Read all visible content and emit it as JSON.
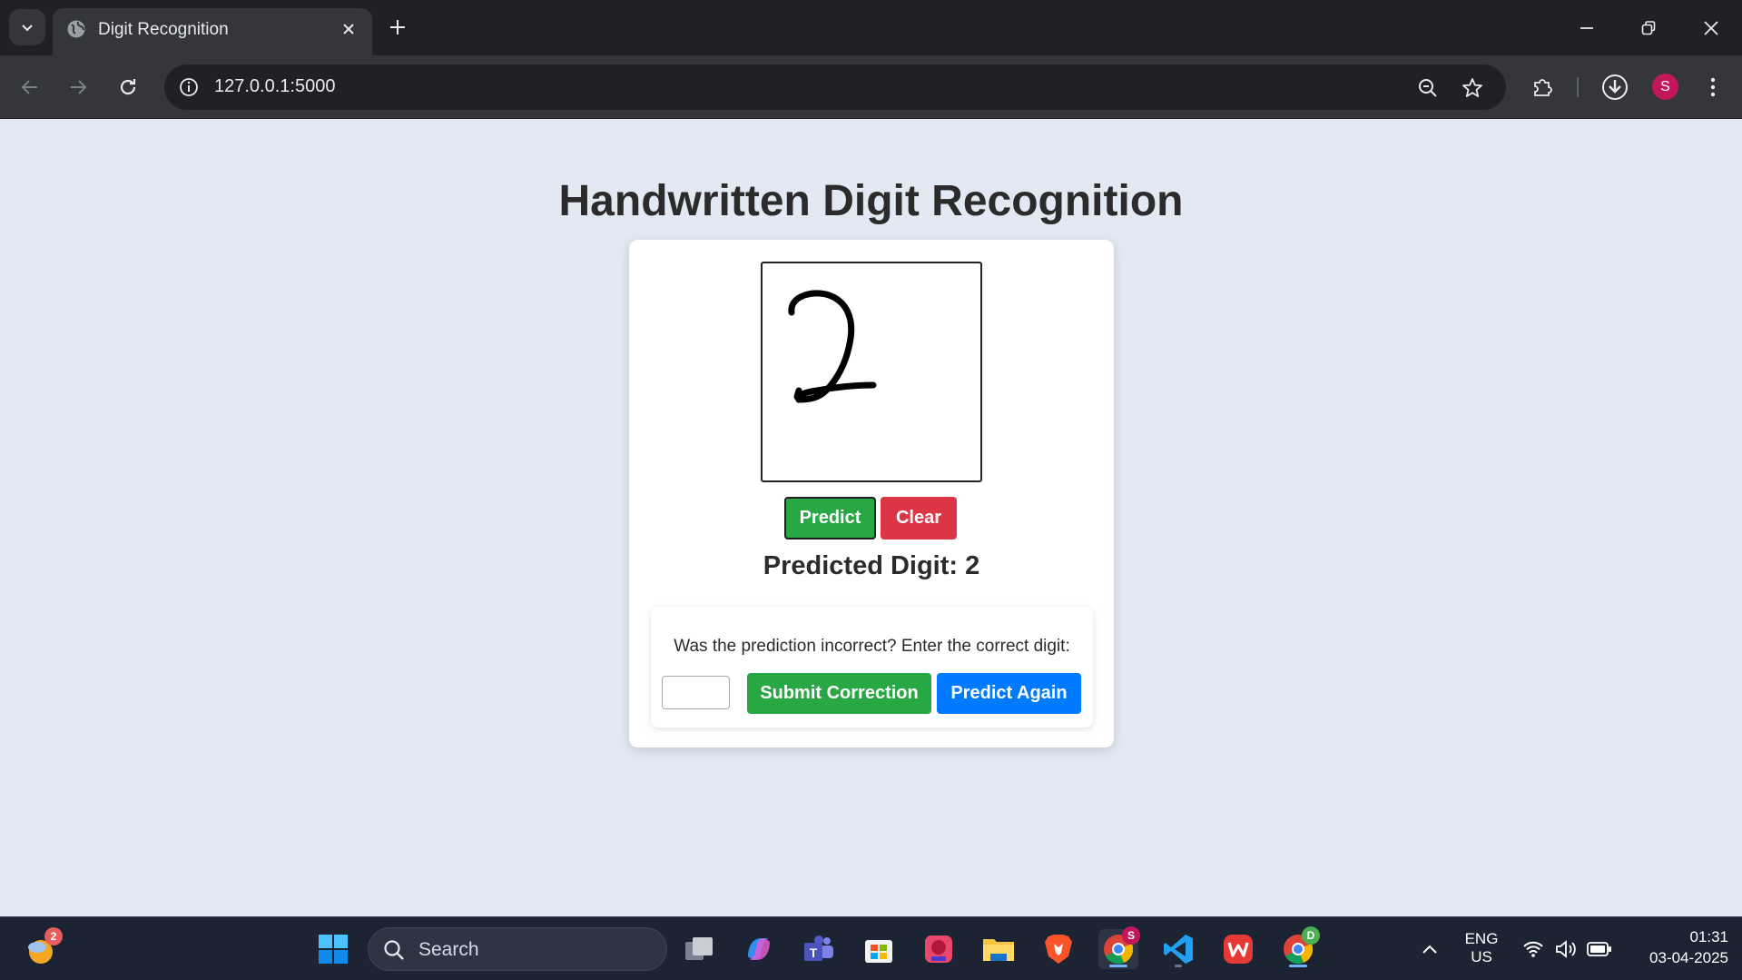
{
  "browser": {
    "tab_title": "Digit Recognition",
    "url": "127.0.0.1:5000",
    "profile_initial": "S"
  },
  "page": {
    "heading": "Handwritten Digit Recognition",
    "canvas_digit": "2",
    "predict_label": "Predict",
    "clear_label": "Clear",
    "result_text": "Predicted Digit: 2",
    "correction": {
      "prompt": "Was the prediction incorrect? Enter the correct digit:",
      "input_value": "",
      "submit_label": "Submit Correction",
      "again_label": "Predict Again"
    }
  },
  "taskbar": {
    "search_placeholder": "Search",
    "weather_badge": "2",
    "chrome_profile_badge": "S",
    "chrome2_profile_badge": "D",
    "lang_line1": "ENG",
    "lang_line2": "US",
    "time": "01:31",
    "date": "03-04-2025"
  },
  "colors": {
    "page_bg": "#e3e9f3",
    "predict": "#28a745",
    "clear": "#dc3545",
    "predict_again": "#007bff"
  }
}
